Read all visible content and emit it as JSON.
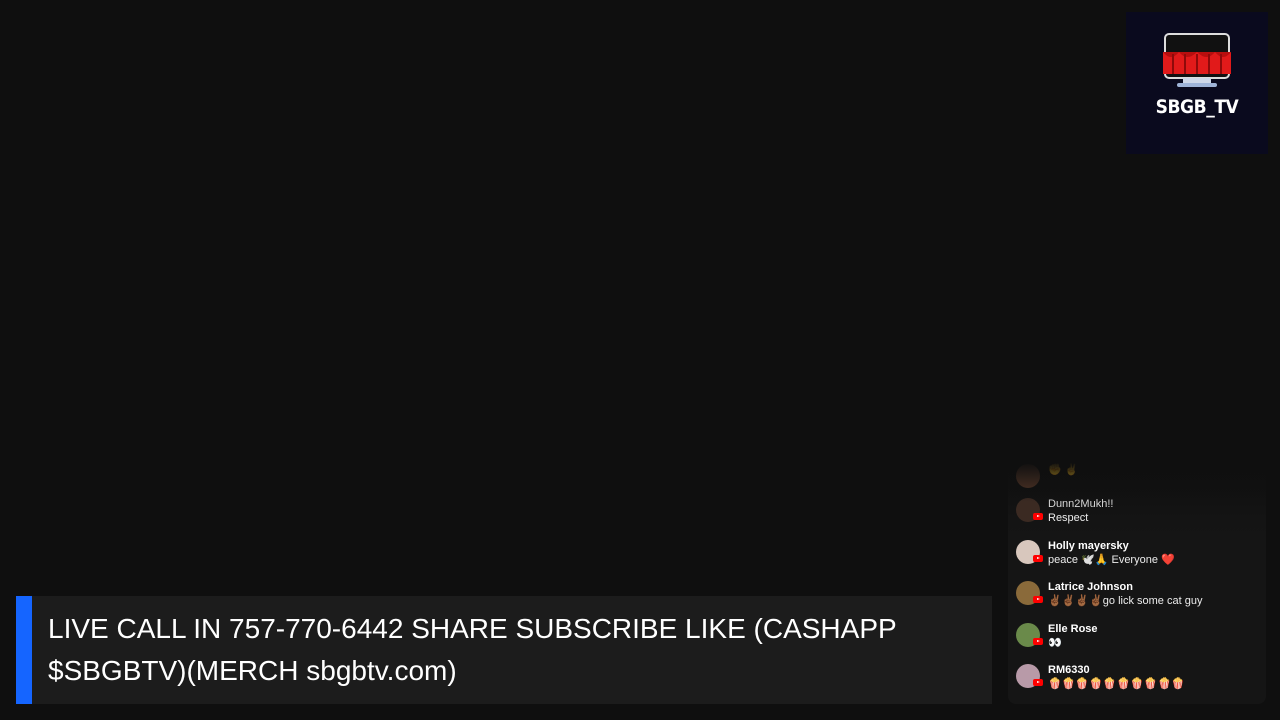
{
  "logo": {
    "text": "SBGB_TV"
  },
  "chat": {
    "messages": [
      {
        "author": "",
        "text": "✊ ✌",
        "avatar_color": "#5a3a2a"
      },
      {
        "author": "Dunn2Mukh!!",
        "text": "Respect",
        "avatar_color": "#3b2a22"
      },
      {
        "author": "Holly mayersky",
        "text": "peace 🕊️🙏 Everyone ❤️",
        "avatar_color": "#d8c7bd"
      },
      {
        "author": "Latrice Johnson",
        "text": "✌🏾✌🏾✌🏾✌🏾go lick some cat guy",
        "avatar_color": "#8a6a3a"
      },
      {
        "author": "Elle Rose",
        "text": "👀",
        "avatar_color": "#6a8a4a"
      },
      {
        "author": "RM6330",
        "text": "🍿🍿🍿🍿🍿🍿🍿🍿🍿🍿",
        "avatar_color": "#b89aa8"
      }
    ]
  },
  "ticker": {
    "text": "LIVE CALL IN 757-770-6442 SHARE SUBSCRIBE LIKE (CASHAPP $SBGBTV)(MERCH sbgbtv.com)",
    "accent_color": "#1565ff"
  }
}
